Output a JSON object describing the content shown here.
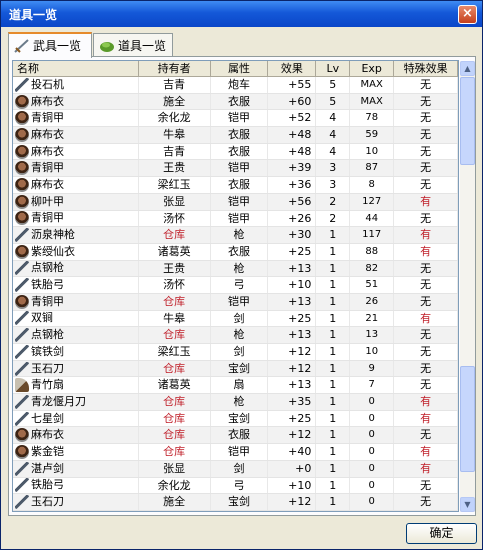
{
  "window": {
    "title": "道具一览",
    "close_label": "×"
  },
  "tabs": [
    {
      "label": "武具一览",
      "icon": "sword-icon",
      "active": true
    },
    {
      "label": "道具一览",
      "icon": "herb-icon",
      "active": false
    }
  ],
  "columns": [
    "名称",
    "持有者",
    "属性",
    "效果",
    "Lv",
    "Exp",
    "特殊效果"
  ],
  "rows": [
    {
      "icon": "catapult-icon",
      "name": "投石机",
      "owner": "吉青",
      "attr": "炮车",
      "effect": "+55",
      "lv": "5",
      "exp": "MAX",
      "special": "无"
    },
    {
      "icon": "armor-icon",
      "name": "麻布衣",
      "owner": "施全",
      "attr": "衣服",
      "effect": "+60",
      "lv": "5",
      "exp": "MAX",
      "special": "无"
    },
    {
      "icon": "armor-icon",
      "name": "青铜甲",
      "owner": "余化龙",
      "attr": "铠甲",
      "effect": "+52",
      "lv": "4",
      "exp": "78",
      "special": "无"
    },
    {
      "icon": "armor-icon",
      "name": "麻布衣",
      "owner": "牛皋",
      "attr": "衣服",
      "effect": "+48",
      "lv": "4",
      "exp": "59",
      "special": "无"
    },
    {
      "icon": "armor-icon",
      "name": "麻布衣",
      "owner": "吉青",
      "attr": "衣服",
      "effect": "+48",
      "lv": "4",
      "exp": "10",
      "special": "无"
    },
    {
      "icon": "armor-icon",
      "name": "青铜甲",
      "owner": "王贵",
      "attr": "铠甲",
      "effect": "+39",
      "lv": "3",
      "exp": "87",
      "special": "无"
    },
    {
      "icon": "armor-icon",
      "name": "麻布衣",
      "owner": "梁红玉",
      "attr": "衣服",
      "effect": "+36",
      "lv": "3",
      "exp": "8",
      "special": "无"
    },
    {
      "icon": "armor-icon",
      "name": "柳叶甲",
      "owner": "张显",
      "attr": "铠甲",
      "effect": "+56",
      "lv": "2",
      "exp": "127",
      "special": "有"
    },
    {
      "icon": "armor-icon",
      "name": "青铜甲",
      "owner": "汤怀",
      "attr": "铠甲",
      "effect": "+26",
      "lv": "2",
      "exp": "44",
      "special": "无"
    },
    {
      "icon": "spear-icon",
      "name": "沥泉神枪",
      "owner": "仓库",
      "attr": "枪",
      "effect": "+30",
      "lv": "1",
      "exp": "117",
      "special": "有"
    },
    {
      "icon": "robe-icon",
      "name": "紫绶仙衣",
      "owner": "诸葛英",
      "attr": "衣服",
      "effect": "+25",
      "lv": "1",
      "exp": "88",
      "special": "有"
    },
    {
      "icon": "spear-icon",
      "name": "点钢枪",
      "owner": "王贵",
      "attr": "枪",
      "effect": "+13",
      "lv": "1",
      "exp": "82",
      "special": "无"
    },
    {
      "icon": "bow-icon",
      "name": "铁胎弓",
      "owner": "汤怀",
      "attr": "弓",
      "effect": "+10",
      "lv": "1",
      "exp": "51",
      "special": "无"
    },
    {
      "icon": "armor-icon",
      "name": "青铜甲",
      "owner": "仓库",
      "attr": "铠甲",
      "effect": "+13",
      "lv": "1",
      "exp": "26",
      "special": "无"
    },
    {
      "icon": "twin-sword-icon",
      "name": "双锏",
      "owner": "牛皋",
      "attr": "剑",
      "effect": "+25",
      "lv": "1",
      "exp": "21",
      "special": "有"
    },
    {
      "icon": "spear-icon",
      "name": "点钢枪",
      "owner": "仓库",
      "attr": "枪",
      "effect": "+13",
      "lv": "1",
      "exp": "13",
      "special": "无"
    },
    {
      "icon": "sword-icon",
      "name": "镔铁剑",
      "owner": "梁红玉",
      "attr": "剑",
      "effect": "+12",
      "lv": "1",
      "exp": "10",
      "special": "无"
    },
    {
      "icon": "blade-icon",
      "name": "玉石刀",
      "owner": "仓库",
      "attr": "宝剑",
      "effect": "+12",
      "lv": "1",
      "exp": "9",
      "special": "无"
    },
    {
      "icon": "fan-icon",
      "name": "青竹扇",
      "owner": "诸葛英",
      "attr": "扇",
      "effect": "+13",
      "lv": "1",
      "exp": "7",
      "special": "无"
    },
    {
      "icon": "blade-icon",
      "name": "青龙偃月刀",
      "owner": "仓库",
      "attr": "枪",
      "effect": "+35",
      "lv": "1",
      "exp": "0",
      "special": "有"
    },
    {
      "icon": "sword-icon",
      "name": "七星剑",
      "owner": "仓库",
      "attr": "宝剑",
      "effect": "+25",
      "lv": "1",
      "exp": "0",
      "special": "有"
    },
    {
      "icon": "armor-icon",
      "name": "麻布衣",
      "owner": "仓库",
      "attr": "衣服",
      "effect": "+12",
      "lv": "1",
      "exp": "0",
      "special": "无"
    },
    {
      "icon": "armor-icon",
      "name": "紫金铠",
      "owner": "仓库",
      "attr": "铠甲",
      "effect": "+40",
      "lv": "1",
      "exp": "0",
      "special": "有"
    },
    {
      "icon": "sword-icon",
      "name": "湛卢剑",
      "owner": "张显",
      "attr": "剑",
      "effect": "+0",
      "lv": "1",
      "exp": "0",
      "special": "有"
    },
    {
      "icon": "bow-icon",
      "name": "铁胎弓",
      "owner": "余化龙",
      "attr": "弓",
      "effect": "+10",
      "lv": "1",
      "exp": "0",
      "special": "无"
    },
    {
      "icon": "blade-icon",
      "name": "玉石刀",
      "owner": "施全",
      "attr": "宝剑",
      "effect": "+12",
      "lv": "1",
      "exp": "0",
      "special": "无"
    }
  ],
  "ok_label": "确定",
  "colors": {
    "store": "#c0202a",
    "special_yes": "#c0202a"
  }
}
